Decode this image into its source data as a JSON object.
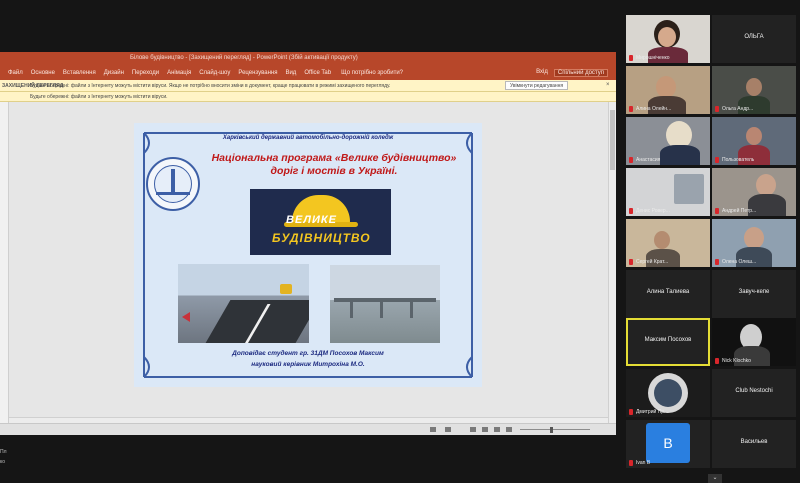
{
  "window": {
    "title": "Білове будівництво - [Захищений перегляд] - PowerPoint (Збій активації продукту)"
  },
  "ribbon": {
    "tabs": [
      "Файл",
      "Основне",
      "Вставлення",
      "Дизайн",
      "Переходи",
      "Анімація",
      "Слайд-шоу",
      "Рецензування",
      "Вид",
      "Office Tab"
    ],
    "tell_me": "Що потрібно зробити?",
    "sign_in": "Вхід",
    "share": "Спільний доступ"
  },
  "protected_view": {
    "label": "ЗАХИЩЕНИЙ ПЕРЕГЛЯД",
    "message": "Будьте обережні: файли з Інтернету можуть містити віруси. Якщо не потрібно вносити зміни в документ, краще працювати в режимі захищеного перегляду.",
    "message2": "Будьте обережні: файли з Інтернету можуть містити віруси.",
    "enable_button": "Увімкнути редагування",
    "close": "×"
  },
  "slide": {
    "institution": "Харківський державний автомобільно-дорожній коледж",
    "title_line1": "Національна програма «Велике будівництво»",
    "title_line2": "доріг і мостів в Україні.",
    "banner_word1": "ВЕЛИКЕ",
    "banner_word2": "БУДІВНИЦТВО",
    "reporter_line1": "Доповідає студент  гр. 31ДМ  Посохов Максим",
    "reporter_line2": "науковий керівник Митрохіна М.О.",
    "colors": {
      "background": "#dbe8f7",
      "title": "#c01818",
      "text": "#1c2a80",
      "frame": "#3d5fa6"
    }
  },
  "gallery": {
    "tiles": [
      {
        "name": "Мирошніченко",
        "type": "video"
      },
      {
        "name": "ОЛЬГА",
        "type": "text"
      },
      {
        "name": "Алина Олейн...",
        "type": "video"
      },
      {
        "name": "Ольга Андр...",
        "type": "video"
      },
      {
        "name": "Анастасия",
        "type": "video"
      },
      {
        "name": "Пользователь",
        "type": "video"
      },
      {
        "name": "Денис Ровер...",
        "type": "video"
      },
      {
        "name": "Андрей Петр...",
        "type": "video"
      },
      {
        "name": "Сергей Крат...",
        "type": "video"
      },
      {
        "name": "Олена Олеш...",
        "type": "video"
      },
      {
        "name": "Алина Талиева",
        "type": "text"
      },
      {
        "name": "Завуч-кепе",
        "type": "text"
      },
      {
        "name": "Максим Посохов",
        "type": "text",
        "active": true
      },
      {
        "name": "Nick Klochko",
        "type": "video"
      },
      {
        "name": "Дмитрий Пр...",
        "type": "video"
      },
      {
        "name": "Club Nestochi",
        "type": "text"
      },
      {
        "name": "Ivan B",
        "type": "avatar",
        "initial": "B"
      },
      {
        "name": "Васильев",
        "type": "text"
      }
    ],
    "more": "⌄",
    "active_color": "#e4dd35"
  },
  "left_edge": {
    "line1": "Пл",
    "line2": "ко"
  }
}
